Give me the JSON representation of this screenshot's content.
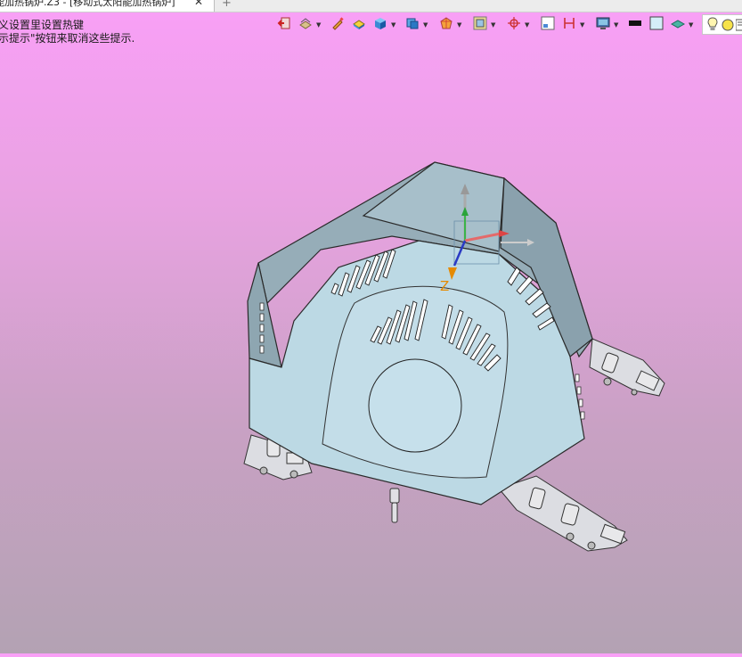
{
  "tab": {
    "title": "能加热锅炉.Z3 - [移动式太阳能加热锅炉]",
    "close_glyph": "✕",
    "new_tab_glyph": "+"
  },
  "hints": {
    "line1": "义设置里设置热键",
    "line2": "示提示\"按钮来取消这些提示."
  },
  "toolbar": {
    "buttons": [
      "exit-icon",
      "layer-icon",
      "pencil-icon",
      "render-icon",
      "cube-icon",
      "view-cube-icon",
      "display-mode-icon",
      "frame-icon",
      "axis-icon",
      "window-icon",
      "grid-icon",
      "monitor-icon",
      "color-black-icon",
      "color-light-icon",
      "plane-icon",
      "bulb-icon",
      "lamp-icon"
    ]
  },
  "viewport": {
    "axis_label": "Z",
    "axis_color": "#e58a00"
  }
}
